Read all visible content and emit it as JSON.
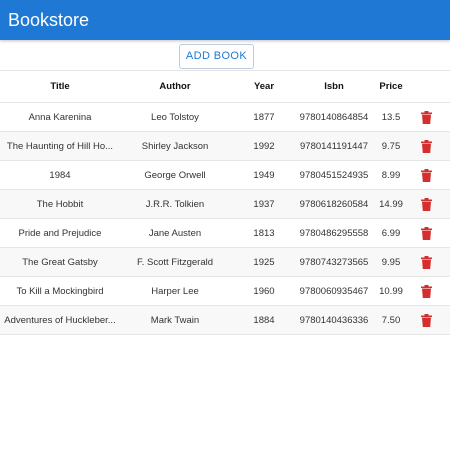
{
  "app": {
    "title": "Bookstore",
    "accent": "#1e78d4",
    "delete_color": "#d32f2f"
  },
  "toolbar": {
    "add_label": "ADD BOOK"
  },
  "table": {
    "columns": [
      "Title",
      "Author",
      "Year",
      "Isbn",
      "Price"
    ],
    "rows": [
      {
        "title": "Anna Karenina",
        "author": "Leo Tolstoy",
        "year": "1877",
        "isbn": "9780140864854",
        "price": "13.5"
      },
      {
        "title": "The Haunting of Hill Ho...",
        "author": "Shirley Jackson",
        "year": "1992",
        "isbn": "9780141191447",
        "price": "9.75"
      },
      {
        "title": "1984",
        "author": "George Orwell",
        "year": "1949",
        "isbn": "9780451524935",
        "price": "8.99"
      },
      {
        "title": "The Hobbit",
        "author": "J.R.R. Tolkien",
        "year": "1937",
        "isbn": "9780618260584",
        "price": "14.99"
      },
      {
        "title": "Pride and Prejudice",
        "author": "Jane Austen",
        "year": "1813",
        "isbn": "9780486295558",
        "price": "6.99"
      },
      {
        "title": "The Great Gatsby",
        "author": "F. Scott Fitzgerald",
        "year": "1925",
        "isbn": "9780743273565",
        "price": "9.95"
      },
      {
        "title": "To Kill a Mockingbird",
        "author": "Harper Lee",
        "year": "1960",
        "isbn": "9780060935467",
        "price": "10.99"
      },
      {
        "title": "Adventures of Huckleber...",
        "author": "Mark Twain",
        "year": "1884",
        "isbn": "9780140436336",
        "price": "7.50"
      }
    ],
    "row_action_icon": "trash-icon"
  }
}
